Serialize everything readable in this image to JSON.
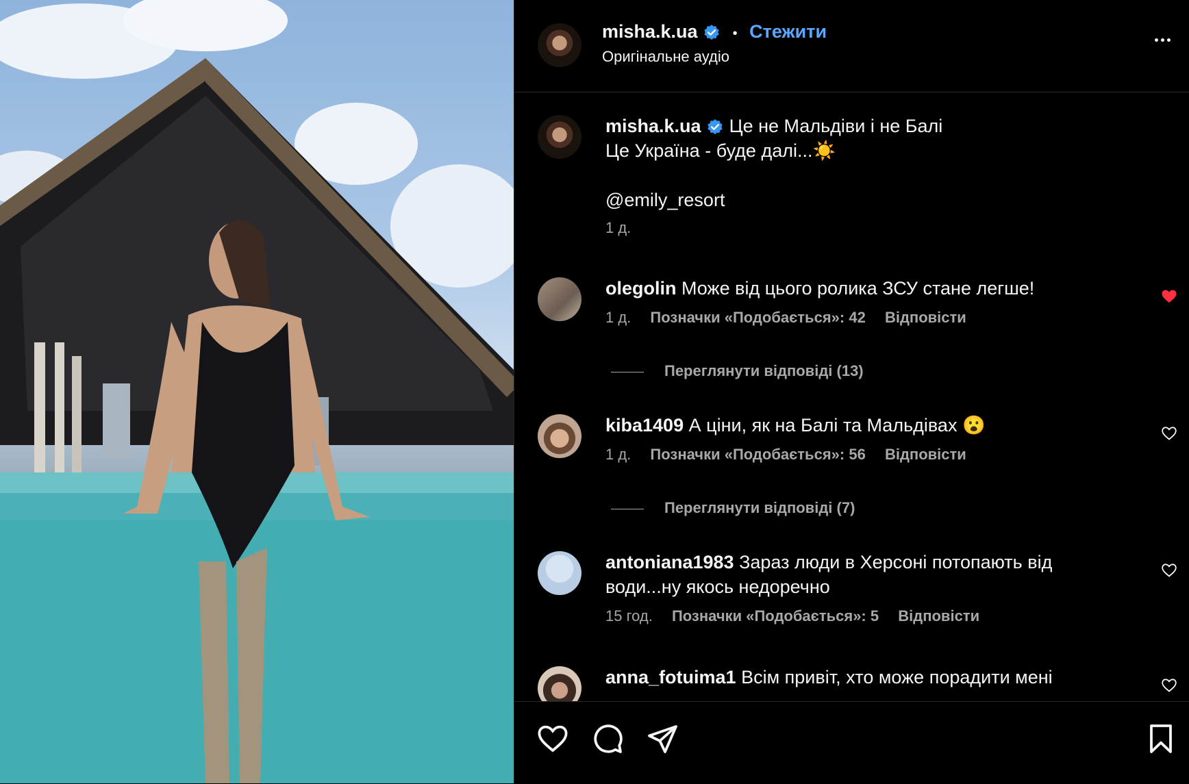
{
  "post": {
    "username": "misha.k.ua",
    "follow_label": "Стежити",
    "dot": "•",
    "audio": "Оригінальне аудіо",
    "caption_line1": "Це не Мальдіви і не Балі",
    "caption_line2": "Це Україна - буде далі...☀️",
    "caption_mention": "@emily_resort",
    "caption_time": "1 д."
  },
  "comments": [
    {
      "username": "olegolin",
      "text": "Може від цього ролика ЗСУ стане легше!",
      "time": "1 д.",
      "likes": "Позначки «Подобається»: 42",
      "reply": "Відповісти",
      "view_replies": "Переглянути відповіді (13)",
      "liked": true
    },
    {
      "username": "kiba1409",
      "text": "А ціни, як на Балі та Мальдівах 😮",
      "time": "1 д.",
      "likes": "Позначки «Подобається»: 56",
      "reply": "Відповісти",
      "view_replies": "Переглянути відповіді (7)",
      "liked": false
    },
    {
      "username": "antoniana1983",
      "text": "Зараз люди в Херсоні потопають від води...ну якось недоречно",
      "time": "15 год.",
      "likes": "Позначки «Подобається»: 5",
      "reply": "Відповісти",
      "liked": false
    },
    {
      "username": "anna_fotuima1",
      "text": "Всім привіт, хто може порадити мені",
      "liked": false
    }
  ],
  "colors": {
    "link": "#5aa7ff",
    "liked_heart": "#ff3040",
    "muted": "#a8a8a8"
  },
  "icons": [
    "verified-icon",
    "more-icon",
    "heart-icon",
    "comment-icon",
    "share-icon",
    "bookmark-icon"
  ]
}
